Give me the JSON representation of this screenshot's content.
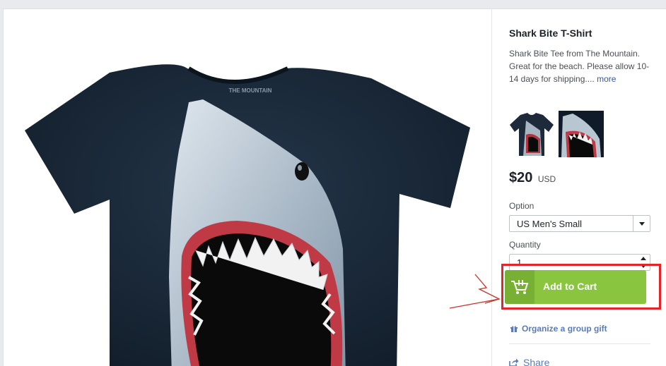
{
  "product": {
    "title": "Shark Bite T-Shirt",
    "description": "Shark Bite Tee from The Mountain. Great for the beach. Please allow 10-14 days for shipping....",
    "more_link": "more",
    "tshirt_logo": "THE MOUNTAIN",
    "price": {
      "amount": "$20",
      "currency": "USD"
    }
  },
  "option": {
    "label": "Option",
    "selected": "US Men's Small",
    "icon": "chevron-down-icon"
  },
  "quantity": {
    "label": "Quantity",
    "value": "1",
    "icon": "number-stepper-icon"
  },
  "cart": {
    "label": "Add to Cart",
    "icon": "shopping-cart-icon",
    "button_color": "#8ac53f",
    "highlight_color": "#e3242b"
  },
  "links": {
    "gift": {
      "label": "Organize a group gift",
      "icon": "gift-icon"
    },
    "share": {
      "label": "Share",
      "icon": "share-icon"
    }
  },
  "colors": {
    "link": "#5b7bb7",
    "shirt": "#1a2736"
  }
}
